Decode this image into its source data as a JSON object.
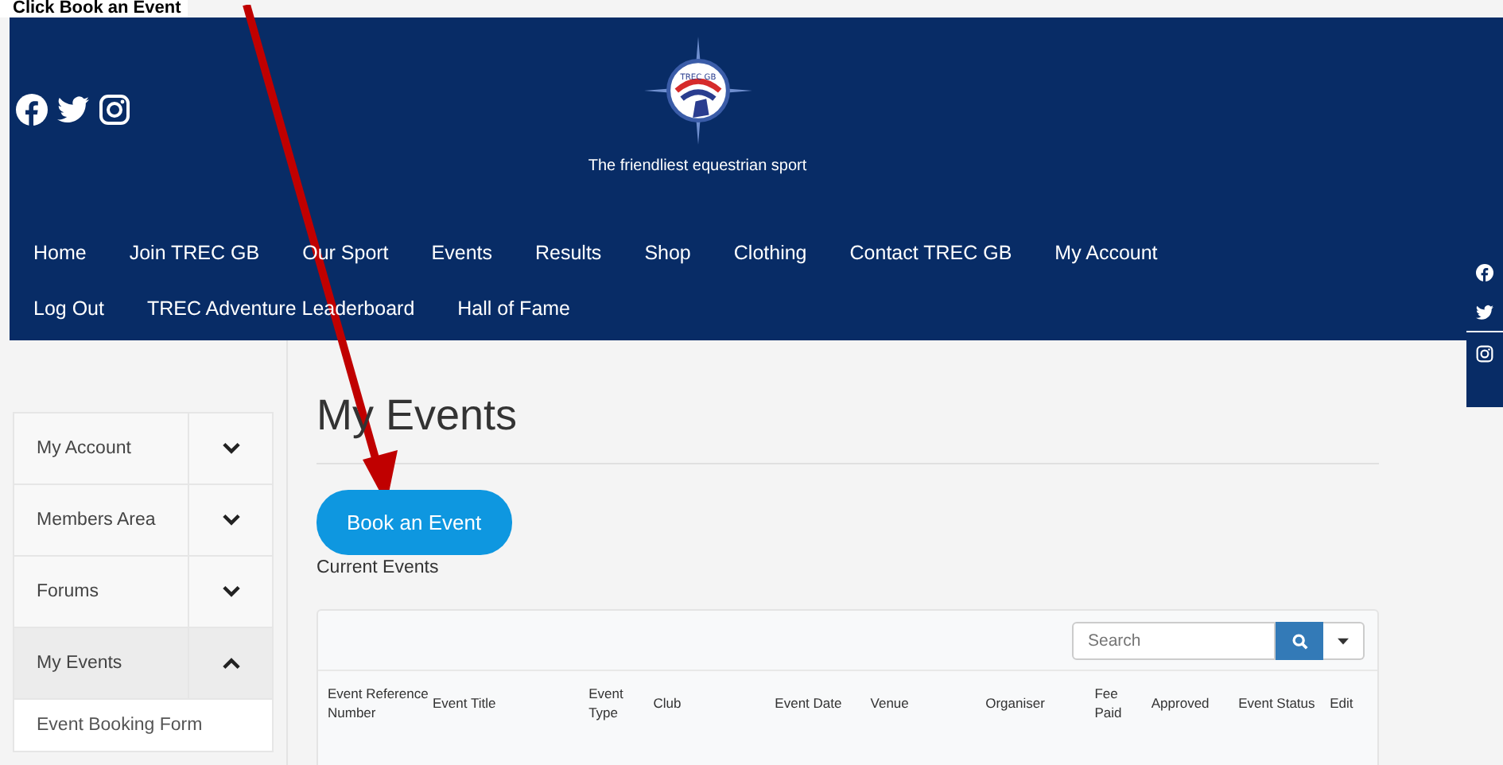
{
  "caption": "Click Book an Event",
  "header": {
    "logo_text": "TREC GB",
    "tagline": "The friendliest equestrian sport"
  },
  "nav": [
    {
      "label": "Home"
    },
    {
      "label": "Join TREC GB"
    },
    {
      "label": "Our Sport"
    },
    {
      "label": "Events"
    },
    {
      "label": "Results"
    },
    {
      "label": "Shop"
    },
    {
      "label": "Clothing"
    },
    {
      "label": "Contact TREC GB"
    },
    {
      "label": "My Account"
    },
    {
      "label": "Log Out"
    },
    {
      "label": "TREC Adventure Leaderboard"
    },
    {
      "label": "Hall of Fame"
    }
  ],
  "sidebar": {
    "items": [
      {
        "label": "My Account",
        "expanded": false,
        "selected": false
      },
      {
        "label": "Members Area",
        "expanded": false,
        "selected": false
      },
      {
        "label": "Forums",
        "expanded": false,
        "selected": false
      },
      {
        "label": "My Events",
        "expanded": true,
        "selected": true,
        "children": [
          {
            "label": "Event Booking Form"
          }
        ]
      }
    ]
  },
  "page": {
    "title": "My Events",
    "button": "Book an Event",
    "section": "Current Events"
  },
  "table": {
    "search": {
      "placeholder": "Search"
    },
    "columns": [
      "Event Reference Number",
      "Event Title",
      "Event Type",
      "Club",
      "Event Date",
      "Venue",
      "Organiser",
      "Fee Paid",
      "Approved",
      "Event Status",
      "Edit"
    ]
  }
}
